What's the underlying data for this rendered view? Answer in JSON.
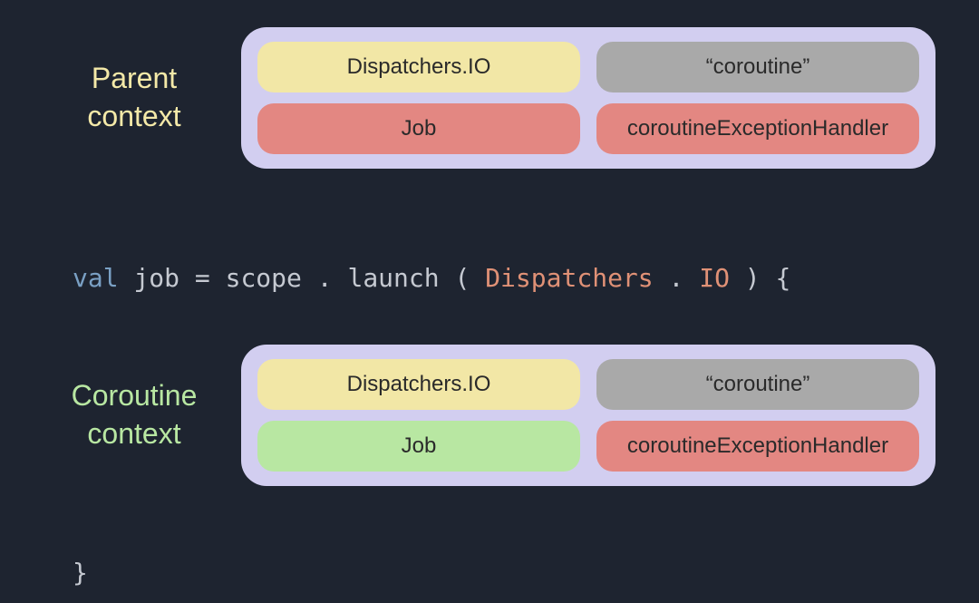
{
  "parent": {
    "label_line1": "Parent",
    "label_line2": "context",
    "dispatcher": "Dispatchers.IO",
    "name": "“coroutine”",
    "job": "Job",
    "handler": "coroutineExceptionHandler"
  },
  "coroutine": {
    "label_line1": "Coroutine",
    "label_line2": "context",
    "dispatcher": "Dispatchers.IO",
    "name": "“coroutine”",
    "job": "Job",
    "handler": "coroutineExceptionHandler"
  },
  "code": {
    "keyword_val": "val",
    "var_job": "job",
    "equals": " = ",
    "scope": "scope",
    "dot1": ".",
    "launch": "launch",
    "lparen": "(",
    "dispatchers": "Dispatchers",
    "dot2": ".",
    "io": "IO",
    "rparen": ")",
    "lbrace": " {",
    "rbrace": "}"
  }
}
